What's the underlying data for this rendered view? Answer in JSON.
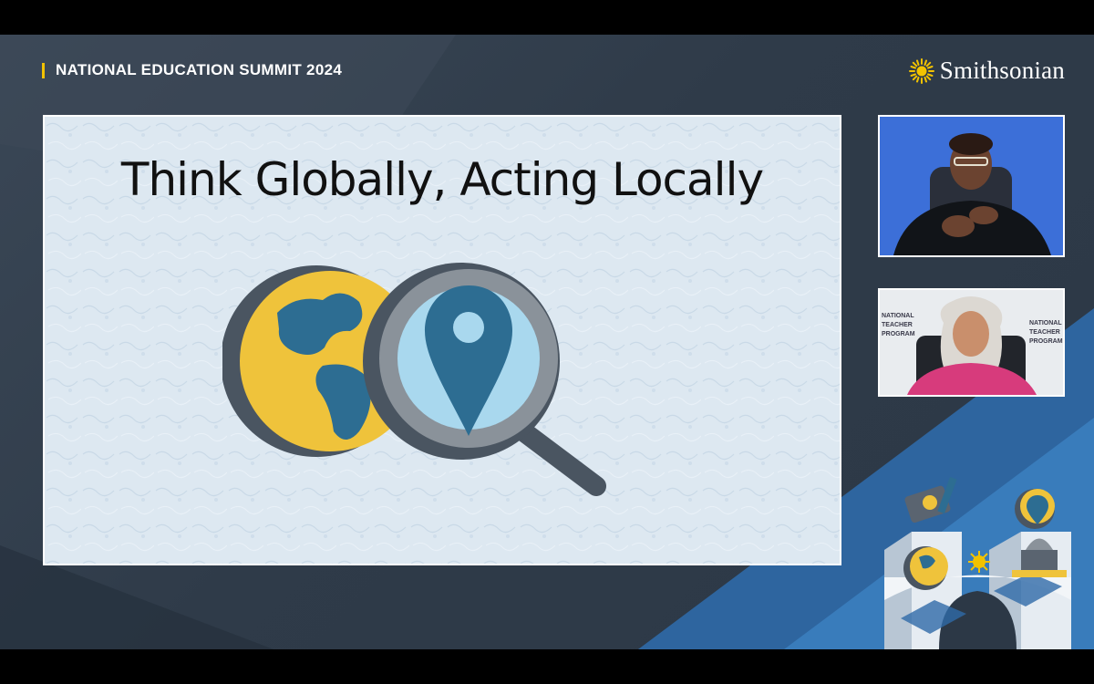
{
  "header": {
    "event_title": "NATIONAL EDUCATION SUMMIT 2024"
  },
  "brand": {
    "name": "Smithsonian",
    "icon": "sun-icon"
  },
  "slide": {
    "title": "Think Globally, Acting Locally",
    "icons": [
      "globe-icon",
      "magnifier-icon",
      "map-pin-icon"
    ]
  },
  "videos": [
    {
      "name": "interpreter-video",
      "icon": "person-icon"
    },
    {
      "name": "speaker-video",
      "icon": "person-icon",
      "backdrop_logo_text": "NATIONAL TEACHER PROGRAM"
    }
  ],
  "colors": {
    "accent_yellow": "#f2c200",
    "globe_yellow": "#efc33b",
    "pin_blue": "#2d6d92",
    "slide_bg": "#dde8f1",
    "stage_bg": "#2f3b49"
  }
}
